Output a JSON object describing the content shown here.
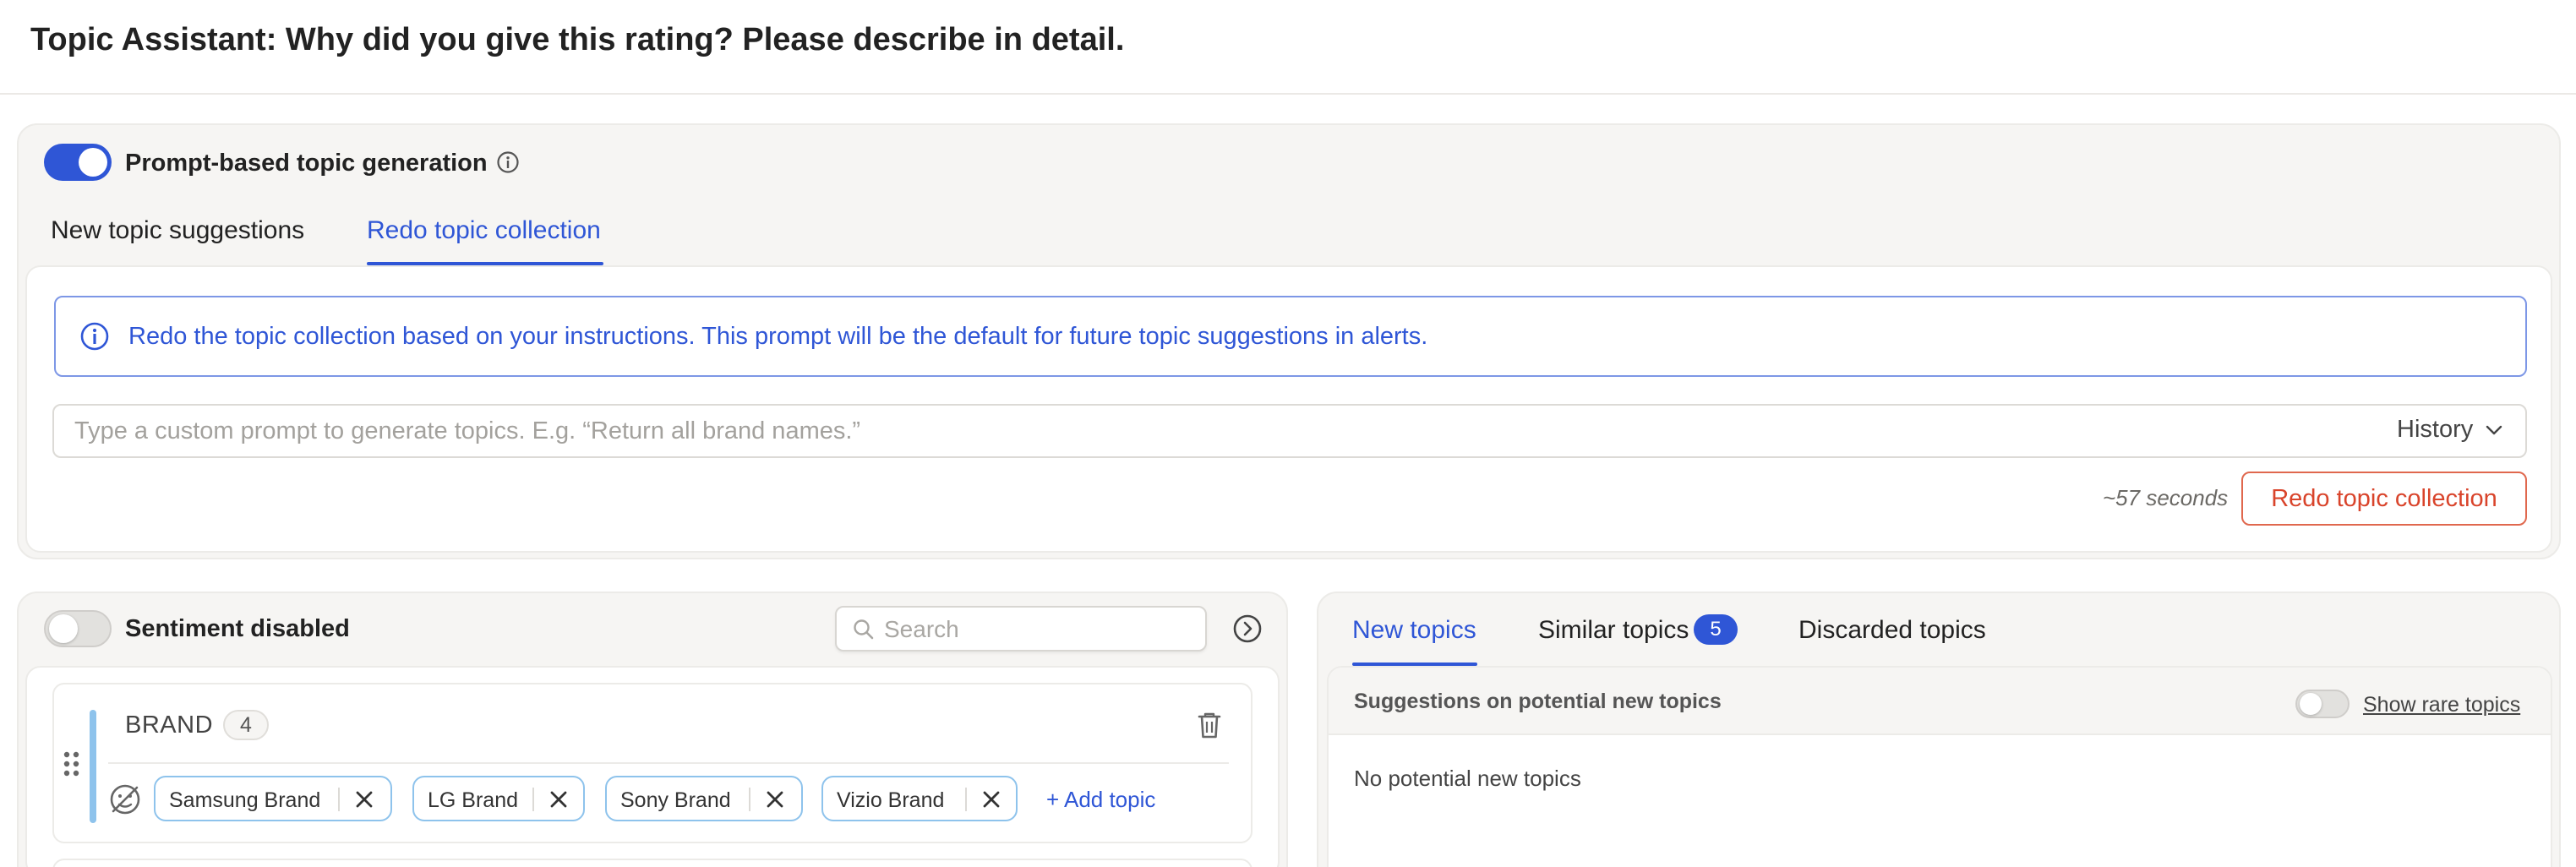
{
  "header": {
    "title": "Topic Assistant: Why did you give this rating? Please describe in detail."
  },
  "prompt_panel": {
    "toggle_label": "Prompt-based topic generation",
    "tabs": [
      {
        "label": "New topic suggestions",
        "active": false
      },
      {
        "label": "Redo topic collection",
        "active": true
      }
    ],
    "info_text": "Redo the topic collection based on your instructions. This prompt will be the default for future topic suggestions in alerts.",
    "prompt_input": {
      "value": "",
      "placeholder": "Type a custom prompt to generate topics. E.g. “Return all brand names.”"
    },
    "history_label": "History",
    "estimate": "~57 seconds",
    "redo_button": "Redo topic collection"
  },
  "left_panel": {
    "sentiment_label": "Sentiment disabled",
    "search_placeholder": "Search",
    "group": {
      "name": "BRAND",
      "count": "4",
      "topics": [
        "Samsung Brand",
        "LG Brand",
        "Sony Brand",
        "Vizio Brand"
      ],
      "add_label": "+ Add topic"
    }
  },
  "right_panel": {
    "tabs": [
      {
        "label": "New topics",
        "active": true
      },
      {
        "label": "Similar topics",
        "active": false,
        "badge": "5"
      },
      {
        "label": "Discarded topics",
        "active": false
      }
    ],
    "section_title": "Suggestions on potential new topics",
    "rare_label": "Show rare topics",
    "empty_text": "No potential new topics"
  },
  "colors": {
    "accent": "#2f56d6",
    "danger": "#d9442b",
    "chip_border": "#8ec3ec",
    "group_bar": "#8ec3ec"
  },
  "icons": [
    "info-icon",
    "chevron-down-icon",
    "search-icon",
    "arrow-right-circle-icon",
    "trash-icon",
    "drag-handle-icon",
    "sentiment-off-icon",
    "close-icon"
  ]
}
